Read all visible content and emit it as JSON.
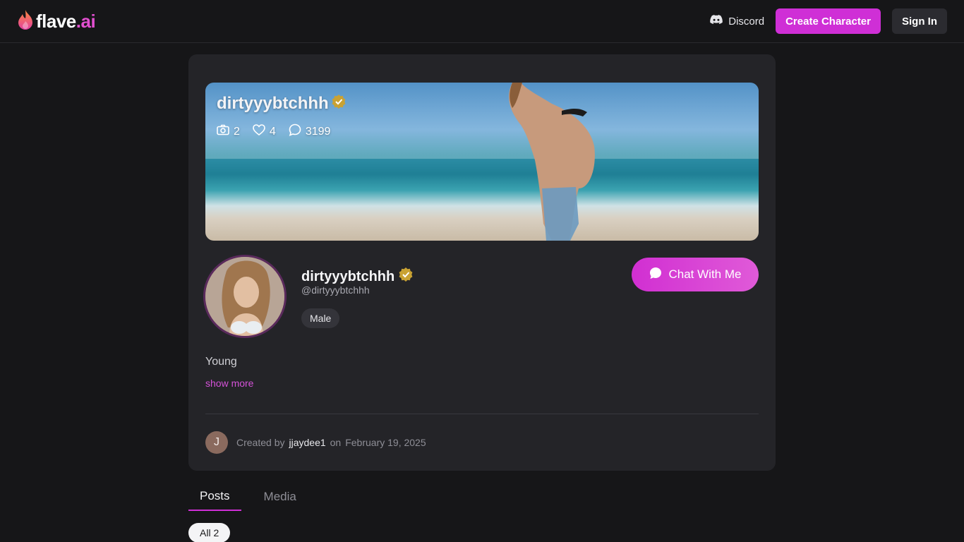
{
  "header": {
    "logo_text": "flave",
    "logo_suffix": ".ai",
    "discord_label": "Discord",
    "create_label": "Create Character",
    "signin_label": "Sign In"
  },
  "banner": {
    "name": "dirtyyybtchhh",
    "stats": {
      "photos": "2",
      "likes": "4",
      "chats": "3199"
    }
  },
  "profile": {
    "name": "dirtyyybtchhh",
    "handle": "@dirtyyybtchhh",
    "tag": "Male",
    "chat_label": "Chat With Me",
    "bio": "Young",
    "show_more": "show more"
  },
  "creator": {
    "initial": "J",
    "prefix": "Created by",
    "name": "jjaydee1",
    "on": "on",
    "date": "February 19, 2025"
  },
  "tabs": [
    {
      "label": "Posts",
      "active": true
    },
    {
      "label": "Media",
      "active": false
    }
  ],
  "filter": {
    "label": "All 2"
  },
  "colors": {
    "accent": "#cf2fd6",
    "background": "#161618",
    "card": "#242428",
    "verified": "#c9a233"
  },
  "icons": [
    "flame-logo-icon",
    "discord-icon",
    "camera-icon",
    "heart-icon",
    "chat-bubble-icon",
    "verified-badge-icon"
  ]
}
